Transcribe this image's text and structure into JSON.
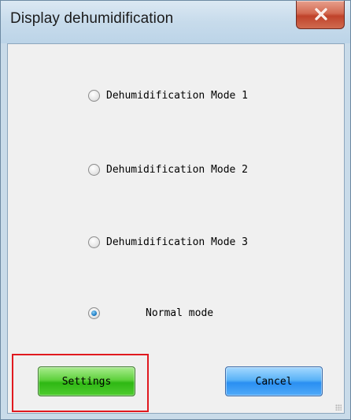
{
  "window": {
    "title": "Display dehumidification",
    "close_glyph": "X",
    "close_icon": "close-icon"
  },
  "options": [
    {
      "label": "Dehumidification Mode 1",
      "checked": false
    },
    {
      "label": "Dehumidification Mode 2",
      "checked": false
    },
    {
      "label": "Dehumidification Mode 3",
      "checked": false
    },
    {
      "label": "Normal mode",
      "checked": true
    }
  ],
  "buttons": {
    "settings_label": "Settings",
    "cancel_label": "Cancel"
  },
  "colors": {
    "settings_button": "#4fcc2f",
    "cancel_button": "#50aaf8",
    "highlight_box": "#e0191f",
    "radio_checked": "#1f7fc8"
  }
}
